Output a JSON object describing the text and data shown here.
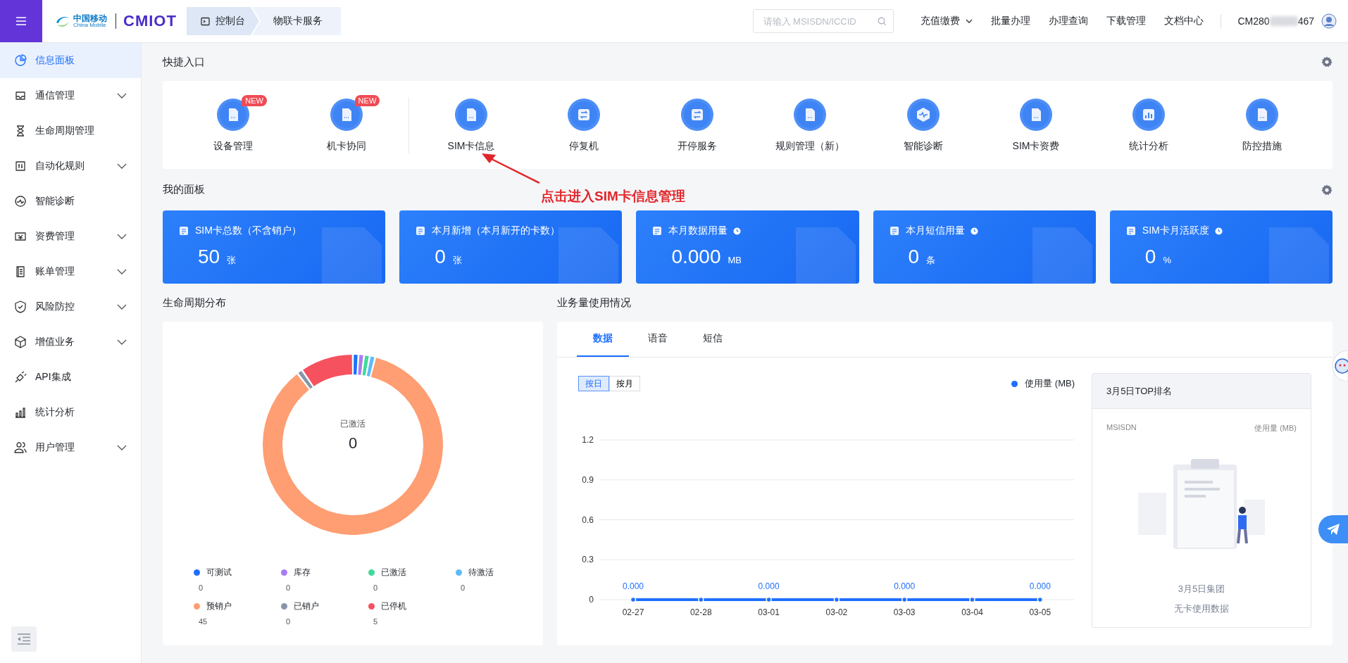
{
  "topbar": {
    "brand_cn": "中国移动",
    "brand_en": "China Mobile",
    "product": "CMIOT",
    "breadcrumbs": [
      {
        "label": "控制台",
        "selected": true
      },
      {
        "label": "物联卡服务",
        "selected": false
      }
    ],
    "search": {
      "placeholder": "请输入 MSISDN/ICCID"
    },
    "nav": [
      {
        "label": "充值缴费",
        "dropdown": true
      },
      {
        "label": "批量办理",
        "dropdown": false
      },
      {
        "label": "办理查询",
        "dropdown": false
      },
      {
        "label": "下载管理",
        "dropdown": false
      },
      {
        "label": "文档中心",
        "dropdown": false
      }
    ],
    "user": {
      "id_start": "CM280",
      "id_end": "467"
    }
  },
  "sidebar": {
    "items": [
      {
        "label": "信息面板",
        "selected": true,
        "expandable": false
      },
      {
        "label": "通信管理",
        "selected": false,
        "expandable": true
      },
      {
        "label": "生命周期管理",
        "selected": false,
        "expandable": false
      },
      {
        "label": "自动化规则",
        "selected": false,
        "expandable": true
      },
      {
        "label": "智能诊断",
        "selected": false,
        "expandable": false
      },
      {
        "label": "资费管理",
        "selected": false,
        "expandable": true
      },
      {
        "label": "账单管理",
        "selected": false,
        "expandable": true
      },
      {
        "label": "风险防控",
        "selected": false,
        "expandable": true
      },
      {
        "label": "增值业务",
        "selected": false,
        "expandable": true
      },
      {
        "label": "API集成",
        "selected": false,
        "expandable": false
      },
      {
        "label": "统计分析",
        "selected": false,
        "expandable": false
      },
      {
        "label": "用户管理",
        "selected": false,
        "expandable": true
      }
    ]
  },
  "quick_entry": {
    "title": "快捷入口",
    "groups": [
      [
        {
          "label": "设备管理",
          "badge": "NEW"
        },
        {
          "label": "机卡协同",
          "badge": "NEW"
        }
      ],
      [
        {
          "label": "SIM卡信息"
        },
        {
          "label": "停复机"
        },
        {
          "label": "开停服务"
        },
        {
          "label": "规则管理（新）"
        },
        {
          "label": "智能诊断"
        },
        {
          "label": "SIM卡资费"
        },
        {
          "label": "统计分析"
        },
        {
          "label": "防控措施"
        }
      ]
    ]
  },
  "annotation": "点击进入SIM卡信息管理",
  "my_panel": {
    "title": "我的面板",
    "cards": [
      {
        "title": "SIM卡总数（不含销户）",
        "value": "50",
        "unit": "张",
        "timed": false
      },
      {
        "title": "本月新增（本月新开的卡数）",
        "value": "0",
        "unit": "张",
        "timed": false
      },
      {
        "title": "本月数据用量",
        "value": "0.000",
        "unit": "MB",
        "timed": true
      },
      {
        "title": "本月短信用量",
        "value": "0",
        "unit": "条",
        "timed": true
      },
      {
        "title": "SIM卡月活跃度",
        "value": "0",
        "unit": "%",
        "timed": true
      }
    ]
  },
  "lifecycle": {
    "title": "生命周期分布",
    "center_label": "已激活",
    "center_value": "0",
    "legend": [
      {
        "label": "可测试",
        "count": "0",
        "color": "#1e6fff"
      },
      {
        "label": "库存",
        "count": "0",
        "color": "#a97cf5"
      },
      {
        "label": "已激活",
        "count": "0",
        "color": "#3fd99a"
      },
      {
        "label": "待激活",
        "count": "0",
        "color": "#5cbcf7"
      },
      {
        "label": "预销户",
        "count": "45",
        "color": "#fe9e72"
      },
      {
        "label": "已销户",
        "count": "0",
        "color": "#8795a8"
      },
      {
        "label": "已停机",
        "count": "5",
        "color": "#f5515f"
      }
    ]
  },
  "usage": {
    "title": "业务量使用情况",
    "tabs": [
      {
        "label": "数据",
        "selected": true
      },
      {
        "label": "语音",
        "selected": false
      },
      {
        "label": "短信",
        "selected": false
      }
    ],
    "period_toggle": [
      {
        "label": "按日",
        "selected": true
      },
      {
        "label": "按月",
        "selected": false
      }
    ],
    "chart_data": {
      "type": "line",
      "categories": [
        "02-27",
        "02-28",
        "03-01",
        "03-02",
        "03-03",
        "03-04",
        "03-05"
      ],
      "series": [
        {
          "name": "使用量 (MB)",
          "color": "#1e6fff",
          "marker": "circle",
          "values": [
            0,
            0,
            0,
            0,
            0,
            0,
            0
          ]
        }
      ],
      "grid": true,
      "ylim": [
        0,
        1.2
      ],
      "yticks": [
        0,
        0.3,
        0.6,
        0.9,
        1.2
      ],
      "value_labels": [
        "0.000",
        null,
        "0.000",
        null,
        "0.000",
        null,
        "0.000"
      ]
    },
    "ranking": {
      "title": "3月5日TOP排名",
      "columns": [
        "MSISDN",
        "使用量 (MB)"
      ],
      "empty_title": "3月5日集团",
      "empty_text": "无卡使用数据"
    }
  }
}
